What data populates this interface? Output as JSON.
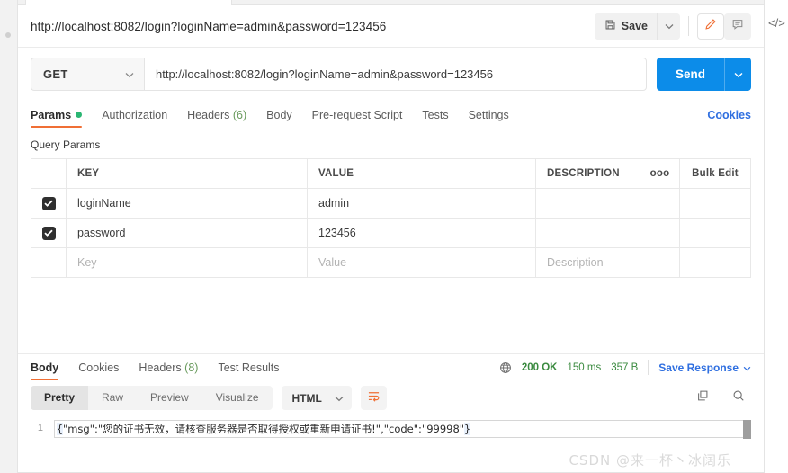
{
  "request": {
    "title": "http://localhost:8082/login?loginName=admin&password=123456",
    "method": "GET",
    "url": "http://localhost:8082/login?loginName=admin&password=123456",
    "send_label": "Send"
  },
  "toolbar": {
    "save_label": "Save",
    "save_icon": "floppy-disk-icon",
    "caret_icon": "chevron-down-icon",
    "pencil_icon": "pencil-icon",
    "comment_icon": "comment-icon",
    "code_icon": "</>"
  },
  "request_tabs": [
    {
      "label": "Params",
      "active": true,
      "dot": true
    },
    {
      "label": "Authorization",
      "active": false,
      "dot": false
    },
    {
      "label": "Headers",
      "count": "(6)",
      "active": false,
      "dot": false
    },
    {
      "label": "Body",
      "active": false,
      "dot": false
    },
    {
      "label": "Pre-request Script",
      "active": false,
      "dot": false
    },
    {
      "label": "Tests",
      "active": false,
      "dot": false
    },
    {
      "label": "Settings",
      "active": false,
      "dot": false
    }
  ],
  "cookies_link": "Cookies",
  "query_params": {
    "section_label": "Query Params",
    "columns": [
      "KEY",
      "VALUE",
      "DESCRIPTION"
    ],
    "dots_label": "ooo",
    "bulk_edit_label": "Bulk Edit",
    "rows": [
      {
        "checked": true,
        "key": "loginName",
        "value": "admin",
        "description": ""
      },
      {
        "checked": true,
        "key": "password",
        "value": "123456",
        "description": ""
      }
    ],
    "placeholder_row": {
      "key": "Key",
      "value": "Value",
      "description": "Description"
    }
  },
  "response": {
    "tabs": [
      {
        "label": "Body",
        "active": true
      },
      {
        "label": "Cookies",
        "active": false
      },
      {
        "label": "Headers",
        "count": "(8)",
        "active": false
      },
      {
        "label": "Test Results",
        "active": false
      }
    ],
    "status": "200 OK",
    "time": "150 ms",
    "size": "357 B",
    "save_response_label": "Save Response",
    "globe_icon": "globe-icon",
    "view_modes": [
      {
        "label": "Pretty",
        "active": true
      },
      {
        "label": "Raw",
        "active": false
      },
      {
        "label": "Preview",
        "active": false
      },
      {
        "label": "Visualize",
        "active": false
      }
    ],
    "format": "HTML",
    "wrap_icon": "word-wrap-icon",
    "copy_icon": "copy-icon",
    "search_icon": "search-icon",
    "body": {
      "line_number": "1",
      "open_brace": "{",
      "content": "\"msg\":\"您的证书无效，请核查服务器是否取得授权或重新申请证书!\",\"code\":\"99998\"",
      "close_brace": "}"
    }
  },
  "watermark": "CSDN @来一杯丶冰阔乐",
  "colors": {
    "accent_orange": "#f06f35",
    "send_blue": "#0c8ce9",
    "link_blue": "#2f6fe0",
    "status_green": "#3a8a3f",
    "dot_green": "#2bb673"
  }
}
